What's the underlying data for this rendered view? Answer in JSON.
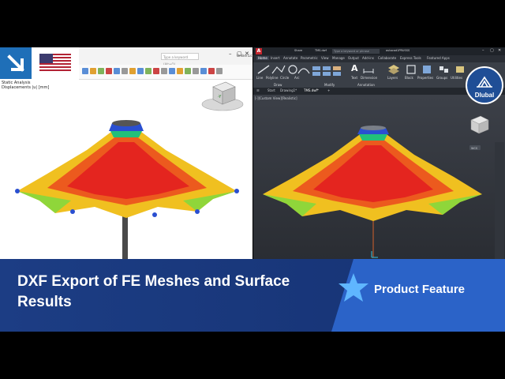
{
  "banner": {
    "title": "DXF Export of FE Meshes and Surface Results",
    "tag": "Product Feature"
  },
  "brand": {
    "name": "Dlubal"
  },
  "left_app": {
    "search_placeholder": "Type a keyword (Alt+Q)",
    "window_title": "Online License 6 | Autodesk AG | Dlubal Software GmbH",
    "info_lines": [
      "Static Analysis",
      "Displacements |u| [mm]"
    ],
    "view_cube_face": "-Y"
  },
  "right_app": {
    "share_label": "Share",
    "file_name": "TMS.dwf",
    "search_placeholder": "Type a keyword or phrase",
    "user": "autocad1PRUSSS",
    "ribbon_tabs": [
      "Home",
      "Insert",
      "Annotate",
      "Parametric",
      "View",
      "Manage",
      "Output",
      "Add-ins",
      "Collaborate",
      "Express Tools",
      "Featured Apps"
    ],
    "ribbon_tools": [
      "Line",
      "Polyline",
      "Circle",
      "Arc",
      "Text",
      "Dimension",
      "Layers",
      "Block",
      "Properties",
      "Groups",
      "Utilities",
      "Clipboard",
      "View"
    ],
    "ribbon_panels": [
      "Draw",
      "Modify",
      "Annotation"
    ],
    "doc_tabs": [
      "Start",
      "Drawing1*",
      "TMS.dwf*"
    ],
    "viewport_label": "[-][Custom View][Realistic]",
    "wcs_label": "WCS"
  },
  "colors": {
    "banner_bg": "#1c3d84",
    "banner_accent": "#2b63c8",
    "dlubal_blue": "#1f4e96",
    "contour_high": "#e4251f",
    "contour_mid": "#f2b21d",
    "contour_low": "#2a4fd1"
  }
}
